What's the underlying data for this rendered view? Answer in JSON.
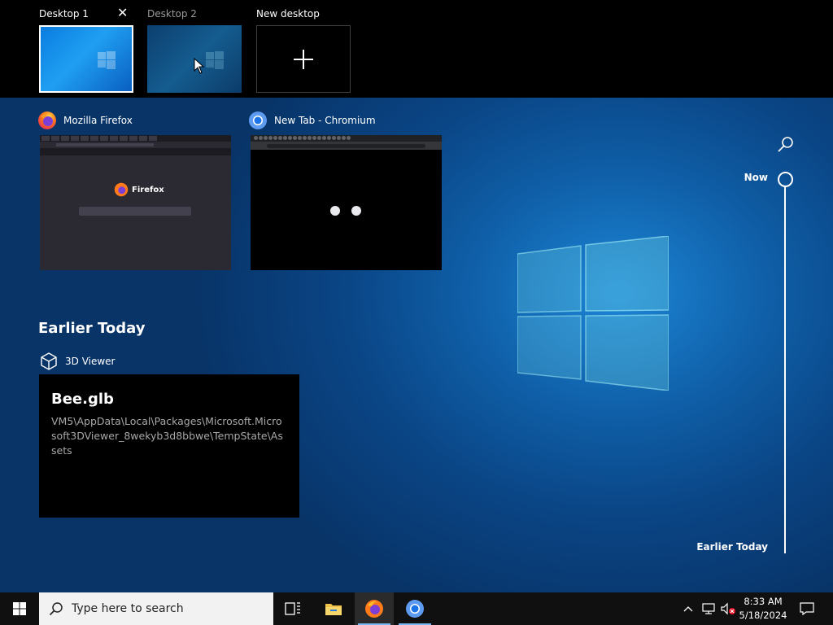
{
  "desktops": [
    {
      "label": "Desktop 1",
      "close_glyph": "✕"
    },
    {
      "label": "Desktop 2"
    },
    {
      "label": "New desktop",
      "add_glyph": "+"
    }
  ],
  "windows": [
    {
      "title": "Mozilla Firefox",
      "icon": "firefox-icon",
      "brand": "Firefox"
    },
    {
      "title": "New Tab - Chromium",
      "icon": "chromium-icon"
    }
  ],
  "earlier": {
    "section_title": "Earlier Today",
    "app": "3D Viewer",
    "icon": "cube-icon",
    "file_name": "Bee.glb",
    "file_path": "VM5\\AppData\\Local\\Packages\\Microsoft.Microsoft3DViewer_8wekyb3d8bbwe\\TempState\\Assets"
  },
  "timeline": {
    "now": "Now",
    "earlier": "Earlier Today"
  },
  "taskbar": {
    "search_placeholder": "Type here to search",
    "time": "8:33 AM",
    "date": "5/18/2024"
  },
  "colors": {
    "accent": "#79b8f2",
    "taskbar": "#101010",
    "selected_border": "#ffffff"
  }
}
